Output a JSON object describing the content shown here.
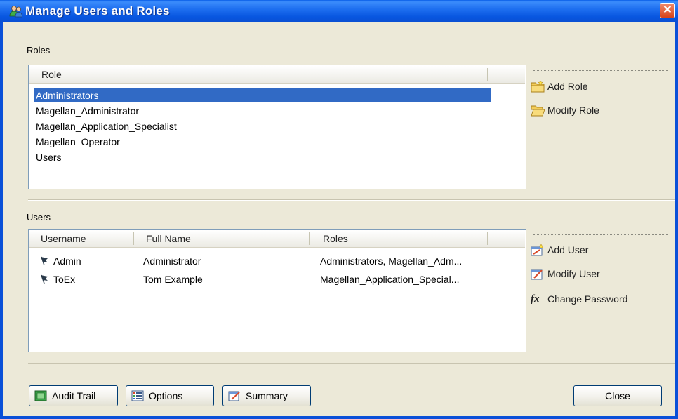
{
  "window": {
    "title": "Manage Users and Roles",
    "close_glyph": "✕"
  },
  "roles": {
    "label": "Roles",
    "column_header": "Role",
    "items": [
      "Administrators",
      "Magellan_Administrator",
      "Magellan_Application_Specialist",
      "Magellan_Operator",
      "Users"
    ],
    "selected": "Administrators",
    "actions": {
      "add": "Add Role",
      "modify": "Modify Role"
    }
  },
  "users": {
    "label": "Users",
    "columns": [
      "Username",
      "Full Name",
      "Roles"
    ],
    "rows": [
      {
        "username": "Admin",
        "full_name": "Administrator",
        "roles": "Administrators, Magellan_Adm..."
      },
      {
        "username": "ToEx",
        "full_name": "Tom Example",
        "roles": "Magellan_Application_Special..."
      }
    ],
    "actions": {
      "add": "Add User",
      "modify": "Modify User",
      "change_password": "Change Password"
    }
  },
  "footer": {
    "audit_trail": "Audit Trail",
    "options": "Options",
    "summary": "Summary",
    "close": "Close"
  },
  "colors": {
    "titlebar": "#0a5fe8",
    "selection": "#316ac5",
    "dialog_bg": "#ece9d8",
    "close_button": "#d8431a"
  }
}
